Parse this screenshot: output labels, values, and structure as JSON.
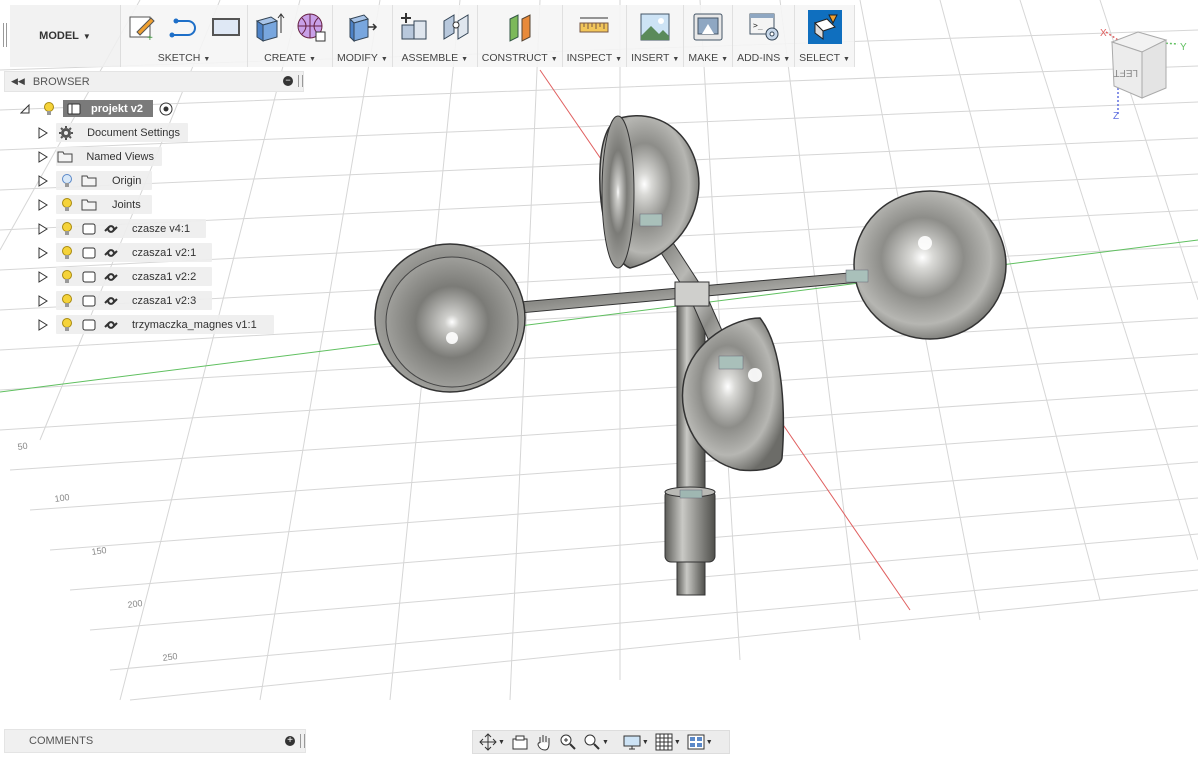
{
  "toolbar": {
    "workspace_label": "MODEL",
    "groups": [
      {
        "label": "SKETCH"
      },
      {
        "label": "CREATE"
      },
      {
        "label": "MODIFY"
      },
      {
        "label": "ASSEMBLE"
      },
      {
        "label": "CONSTRUCT"
      },
      {
        "label": "INSPECT"
      },
      {
        "label": "INSERT"
      },
      {
        "label": "MAKE"
      },
      {
        "label": "ADD-INS"
      },
      {
        "label": "SELECT"
      }
    ]
  },
  "browser": {
    "title": "BROWSER",
    "root": {
      "label": "projekt v2"
    },
    "items": [
      {
        "label": "Document Settings",
        "icon": "gear-icon"
      },
      {
        "label": "Named Views",
        "icon": "folder-icon"
      },
      {
        "label": "Origin",
        "icon": "folder-icon"
      },
      {
        "label": "Joints",
        "icon": "folder-icon"
      },
      {
        "label": "czasze v4:1",
        "icon": "link-icon"
      },
      {
        "label": "czasza1 v2:1",
        "icon": "link-icon"
      },
      {
        "label": "czasza1 v2:2",
        "icon": "link-icon"
      },
      {
        "label": "czasza1 v2:3",
        "icon": "link-icon"
      },
      {
        "label": "trzymaczka_magnes v1:1",
        "icon": "link-icon"
      }
    ]
  },
  "comments": {
    "title": "COMMENTS"
  },
  "viewport": {
    "grid_labels": [
      "50",
      "100",
      "150",
      "200",
      "250"
    ],
    "viewcube": {
      "face": "LEFT",
      "axes": [
        "X",
        "Y",
        "Z"
      ]
    }
  },
  "colors": {
    "accent": "#0f6fbf",
    "x_axis": "#e06060",
    "y_axis": "#60c060",
    "z_axis": "#6070e0"
  }
}
